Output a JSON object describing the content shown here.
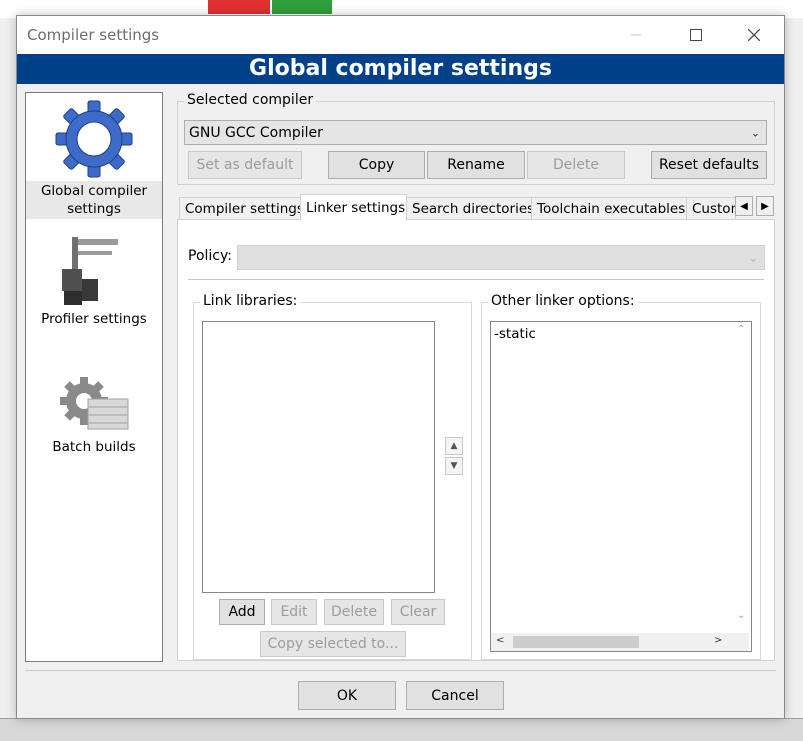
{
  "window": {
    "title": "Compiler settings"
  },
  "banner": {
    "title": "Global compiler settings"
  },
  "sidebar": {
    "items": [
      {
        "label": "Global compiler settings",
        "icon": "gear-icon",
        "selected": true
      },
      {
        "label": "Profiler settings",
        "icon": "profiler-icon",
        "selected": false
      },
      {
        "label": "Batch builds",
        "icon": "batch-builds-icon",
        "selected": false
      }
    ]
  },
  "selected_compiler": {
    "group_title": "Selected compiler",
    "value": "GNU GCC Compiler",
    "buttons": {
      "set_default": "Set as default",
      "copy": "Copy",
      "rename": "Rename",
      "delete": "Delete",
      "reset": "Reset defaults"
    }
  },
  "tabs": [
    {
      "label": "Compiler settings",
      "active": false
    },
    {
      "label": "Linker settings",
      "active": true
    },
    {
      "label": "Search directories",
      "active": false
    },
    {
      "label": "Toolchain executables",
      "active": false
    },
    {
      "label": "Custom variables",
      "active": false
    }
  ],
  "policy": {
    "label": "Policy:",
    "value": ""
  },
  "link_libraries": {
    "title": "Link libraries:",
    "items": [],
    "buttons": {
      "add": "Add",
      "edit": "Edit",
      "delete": "Delete",
      "clear": "Clear",
      "copy_selected": "Copy selected to..."
    }
  },
  "other_linker": {
    "title": "Other linker options:",
    "value": "-static"
  },
  "footer": {
    "ok": "OK",
    "cancel": "Cancel"
  },
  "colors": {
    "banner": "#00418a",
    "window_bg": "#f0f0f0"
  }
}
